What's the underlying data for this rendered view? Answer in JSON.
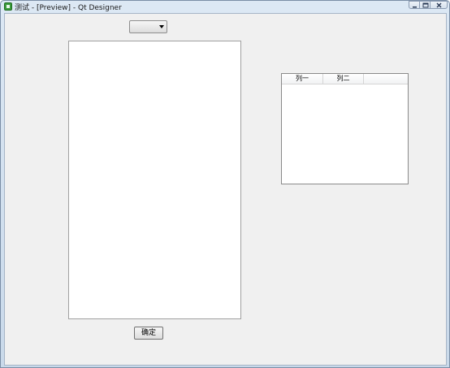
{
  "window": {
    "title": "测试 - [Preview] - Qt Designer",
    "icon": "qt-designer-app-icon"
  },
  "controls": {
    "minimize": "minimize-icon",
    "maximize": "maximize-icon",
    "close": "close-icon"
  },
  "combo": {
    "value": ""
  },
  "table": {
    "headers": [
      "列一",
      "列二"
    ]
  },
  "ok_button": {
    "label": "确定"
  }
}
